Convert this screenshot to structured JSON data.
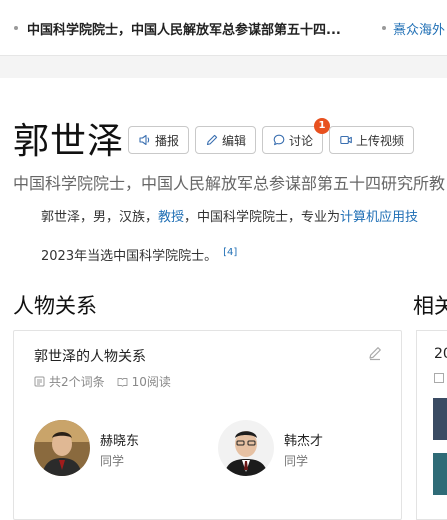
{
  "top_strip": {
    "item1": "中国科学院院士，中国人民解放军总参谋部第五十四...",
    "item2": "熹众海外"
  },
  "entry": {
    "title": "郭世泽",
    "actions": {
      "broadcast": "播报",
      "edit": "编辑",
      "discuss": "讨论",
      "discuss_badge": "1",
      "upload_video": "上传视频"
    },
    "subtitle": "中国科学院院士，中国人民解放军总参谋部第五十四研究所教",
    "summary": {
      "line1_prefix": "郭世泽，男，汉族，",
      "line1_link1": "教授",
      "line1_mid": "，中国科学院院士，专业为",
      "line1_link2": "计算机应用技",
      "line2": "2023年当选中国科学院院士。",
      "ref": "[4]"
    }
  },
  "relations": {
    "heading": "人物关系",
    "heading_right": "相关",
    "card_title": "郭世泽的人物关系",
    "meta_entries": "共2个词条",
    "meta_reads": "10阅读",
    "people": [
      {
        "name": "赫晓东",
        "relation": "同学"
      },
      {
        "name": "韩杰才",
        "relation": "同学"
      }
    ],
    "right_card_num": "20"
  },
  "colors": {
    "link": "#1f6fb5",
    "badge": "#e8511f"
  }
}
